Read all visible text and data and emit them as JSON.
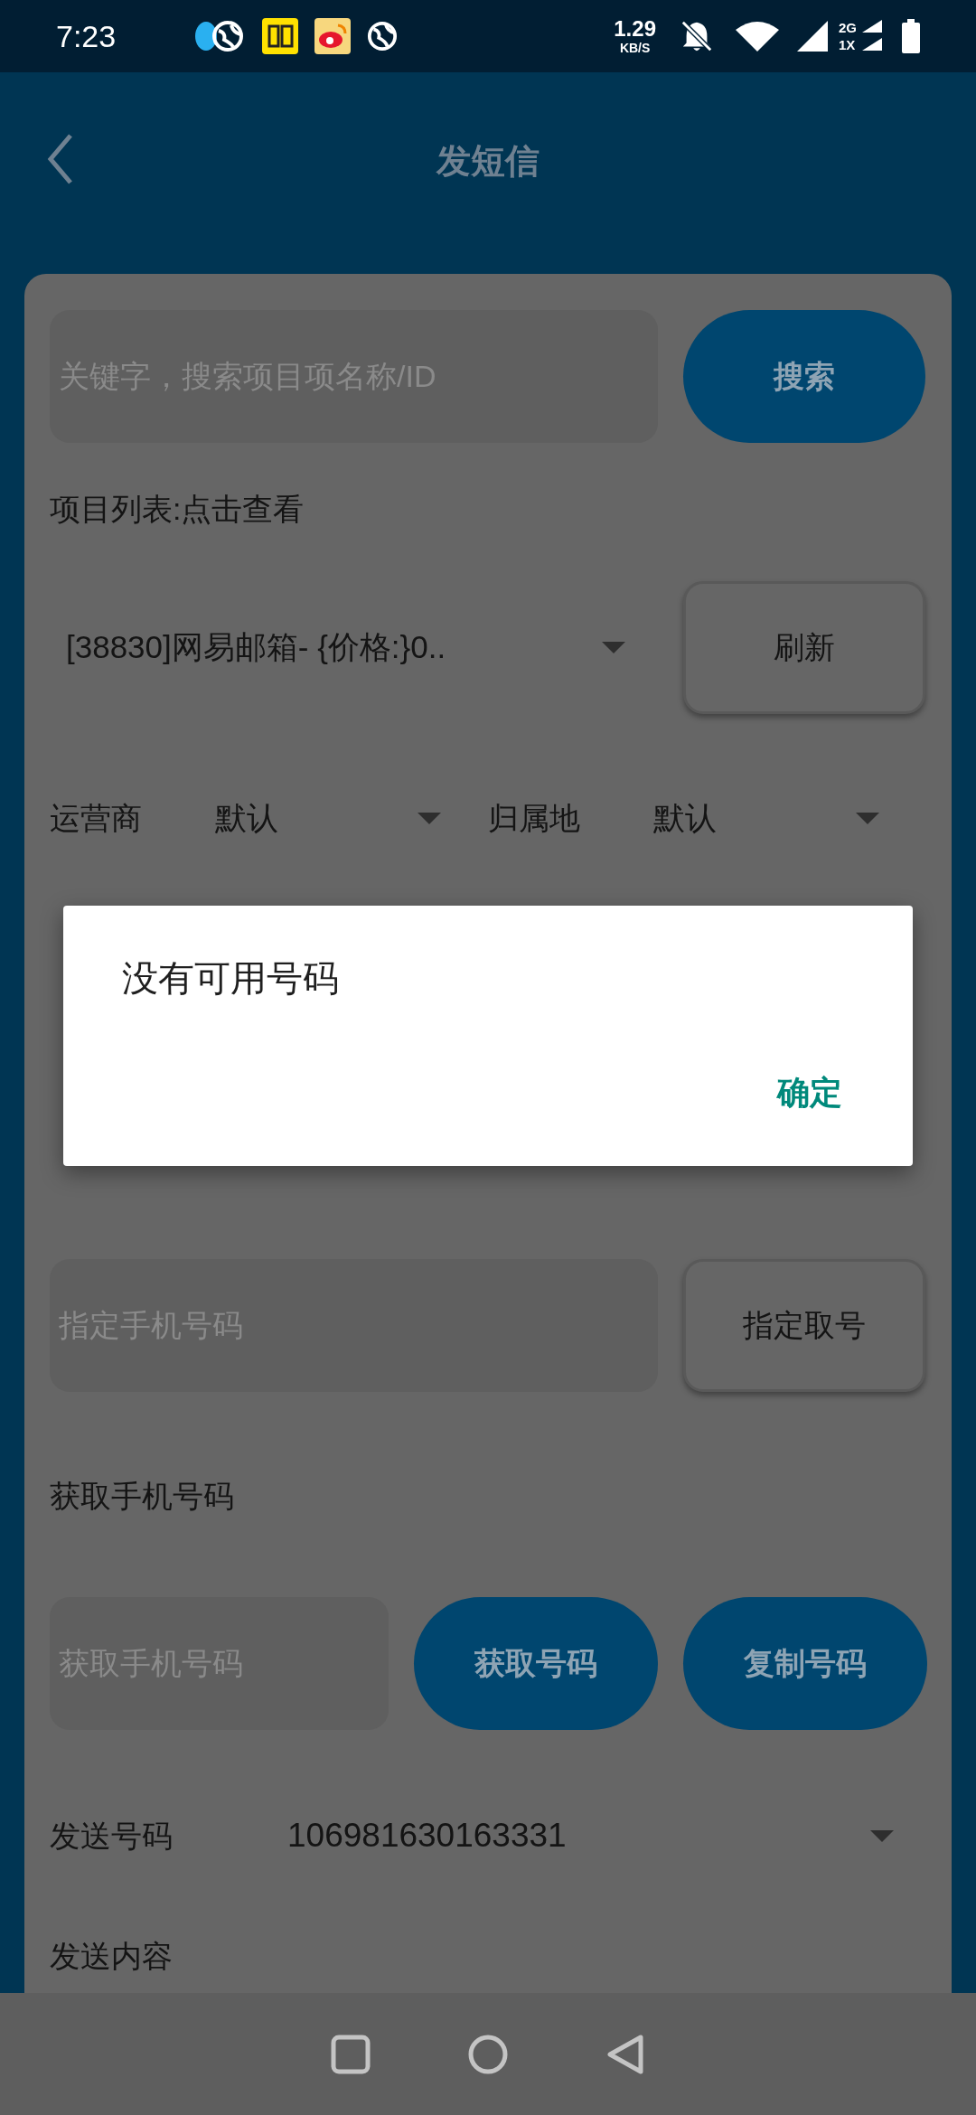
{
  "status_bar": {
    "time": "7:23",
    "net_speed": "1.29",
    "net_unit": "KB/S",
    "network_top": "2G",
    "network_bottom": "1X"
  },
  "header": {
    "title": "发短信"
  },
  "search": {
    "placeholder": "关键字，搜索项目项名称/ID",
    "button": "搜索"
  },
  "project_list_label": "项目列表:点击查看",
  "project_spinner": {
    "value": "[38830]网易邮箱- {价格:}0..",
    "button": "刷新"
  },
  "filters": [
    {
      "label": "运营商",
      "value": "默认"
    },
    {
      "label": "归属地",
      "value": "默认"
    }
  ],
  "designate": {
    "placeholder": "指定手机号码",
    "button": "指定取号"
  },
  "get_number": {
    "label": "获取手机号码",
    "placeholder": "获取手机号码",
    "buttons": [
      "获取号码",
      "复制号码"
    ]
  },
  "sender": {
    "label": "发送号码",
    "value": "106981630163331"
  },
  "content_label": "发送内容",
  "dialog": {
    "message": "没有可用号码",
    "button": "确定"
  }
}
